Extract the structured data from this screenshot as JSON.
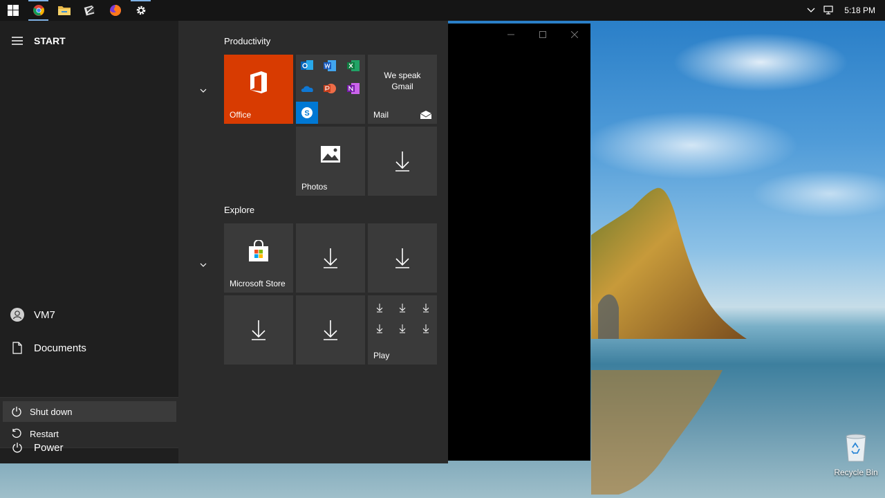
{
  "taskbar": {
    "apps": [
      {
        "icon": "windows-start-icon"
      },
      {
        "icon": "chrome-icon"
      },
      {
        "icon": "file-explorer-icon"
      },
      {
        "icon": "app-icon"
      },
      {
        "icon": "firefox-icon"
      },
      {
        "icon": "settings-gear-icon"
      }
    ],
    "clock": "5:18 PM"
  },
  "start_menu": {
    "header": "START",
    "user": "VM7",
    "documents": "Documents",
    "power_menu": {
      "shut_down": "Shut down",
      "restart": "Restart"
    },
    "power": "Power",
    "groups": [
      {
        "title": "Productivity",
        "tiles": {
          "office": "Office",
          "mail_text": "We speak Gmail",
          "mail": "Mail",
          "photos": "Photos"
        }
      },
      {
        "title": "Explore",
        "tiles": {
          "store": "Microsoft Store",
          "play": "Play"
        }
      }
    ]
  },
  "desktop": {
    "recycle_bin": "Recycle Bin"
  },
  "colors": {
    "office_tile": "#d83b01",
    "skype": "#0078d4",
    "accent": "#7fb2e5"
  }
}
